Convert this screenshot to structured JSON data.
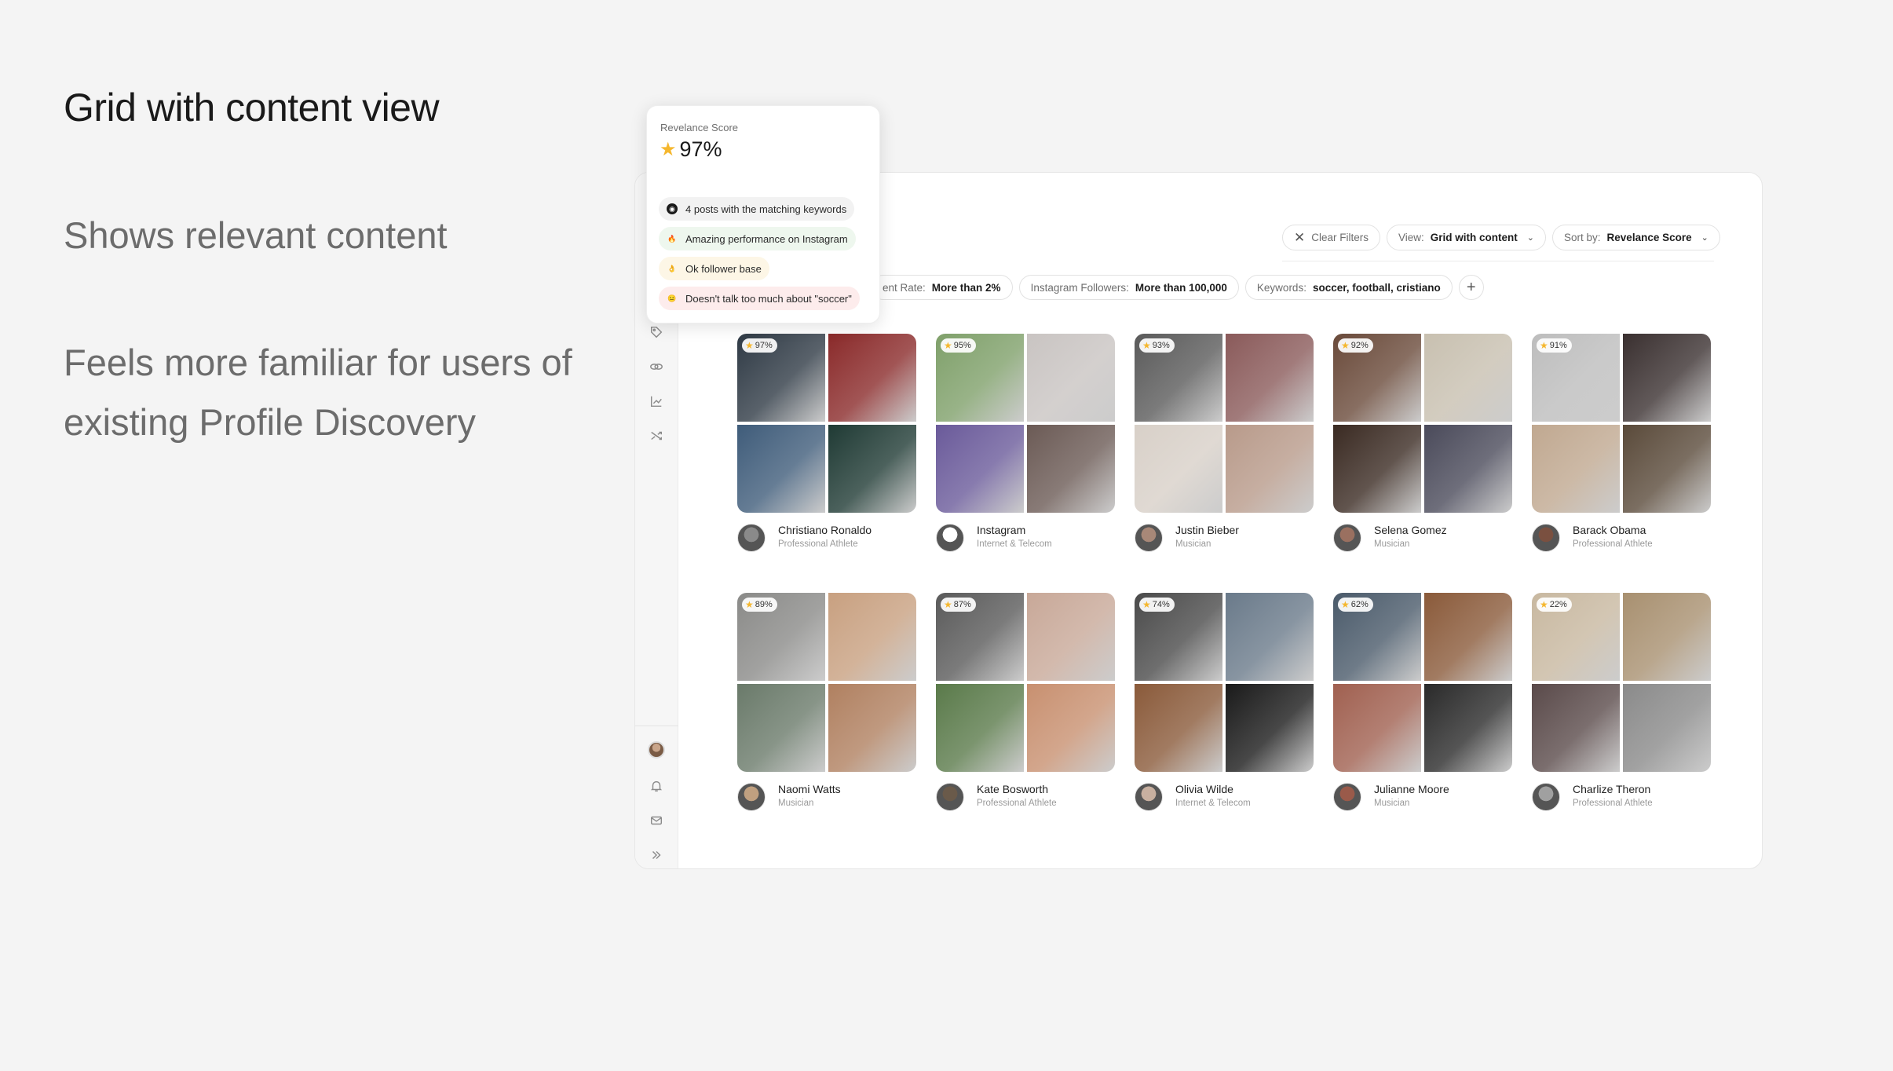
{
  "slide": {
    "title": "Grid with content view",
    "point1": "Shows relevant content",
    "point2": "Feels more familiar for users of existing Profile Discovery"
  },
  "toolbar": {
    "clear_filters": "Clear Filters",
    "view_prefix": "View:",
    "view_value": "Grid with content",
    "sort_prefix": "Sort by:",
    "sort_value": "Revelance Score"
  },
  "filters": [
    {
      "label": "ent Rate:",
      "value": "More than 2%"
    },
    {
      "label": "Instagram Followers:",
      "value": "More than 100,000"
    },
    {
      "label": "Keywords:",
      "value": "soccer, football,  cristiano"
    }
  ],
  "add_filter": "+",
  "tooltip": {
    "label": "Revelance Score",
    "score": "97%",
    "chips": [
      {
        "text": "4 posts with the matching keywords",
        "icon": "instagram-icon",
        "bg": "#f2f2f2"
      },
      {
        "text": "Amazing performance on Instagram",
        "icon": "fire-icon",
        "bg": "#eef7ee"
      },
      {
        "text": "Ok follower base",
        "icon": "thumbs-up-icon",
        "bg": "#fdf6e6"
      },
      {
        "text": "Doesn't talk too much about \"soccer\"",
        "icon": "neutral-face-icon",
        "bg": "#fdecec"
      }
    ]
  },
  "profiles": [
    {
      "name": "Christiano Ronaldo",
      "category": "Professional Athlete",
      "score": "97%",
      "colors": [
        "#2f3a45",
        "#8a2a2a",
        "#3f5c7a",
        "#1f3a34"
      ],
      "avatar": "#8a8a8a"
    },
    {
      "name": "Instagram",
      "category": "Internet & Telecom",
      "score": "95%",
      "colors": [
        "#7fa06a",
        "#c9c4c2",
        "#6a5a9a",
        "#6b5a55"
      ],
      "avatar": "#ffffff"
    },
    {
      "name": "Justin Bieber",
      "category": "Musician",
      "score": "93%",
      "colors": [
        "#5a5a5a",
        "#8a5a5a",
        "#d8d0c8",
        "#b89a8a"
      ],
      "avatar": "#a88878"
    },
    {
      "name": "Selena Gomez",
      "category": "Musician",
      "score": "92%",
      "colors": [
        "#6a4a3a",
        "#c8c0b0",
        "#3a2a22",
        "#4a4a5a"
      ],
      "avatar": "#9a7060"
    },
    {
      "name": "Barack Obama",
      "category": "Professional Athlete",
      "score": "91%",
      "colors": [
        "#bdbdbd",
        "#3a3030",
        "#c0a890",
        "#5a4a3a"
      ],
      "avatar": "#7a5040"
    },
    {
      "name": "Naomi Watts",
      "category": "Musician",
      "score": "89%",
      "colors": [
        "#8a8a88",
        "#c8a080",
        "#6a7a6a",
        "#b08060"
      ],
      "avatar": "#c0a080"
    },
    {
      "name": "Kate Bosworth",
      "category": "Professional Athlete",
      "score": "87%",
      "colors": [
        "#5a5a5a",
        "#c8a898",
        "#5a7a4a",
        "#c89070"
      ],
      "avatar": "#6a5a4a"
    },
    {
      "name": "Olivia Wilde",
      "category": "Internet & Telecom",
      "score": "74%",
      "colors": [
        "#4a4a4a",
        "#6a7a8a",
        "#8a5a3a",
        "#1a1a1a"
      ],
      "avatar": "#c8b0a0"
    },
    {
      "name": "Julianne Moore",
      "category": "Musician",
      "score": "62%",
      "colors": [
        "#4a5a6a",
        "#8a5a3a",
        "#a06050",
        "#2a2a2a"
      ],
      "avatar": "#9a5a4a"
    },
    {
      "name": "Charlize Theron",
      "category": "Professional Athlete",
      "score": "22%",
      "colors": [
        "#c8b8a0",
        "#a89070",
        "#5a4a4a",
        "#8a8a8a"
      ],
      "avatar": "#a0a0a0"
    }
  ],
  "sidebar_icons": [
    "tag-icon",
    "link-icon",
    "chart-icon",
    "shuffle-icon",
    "avatar",
    "bell-icon",
    "mail-icon",
    "expand-icon"
  ]
}
